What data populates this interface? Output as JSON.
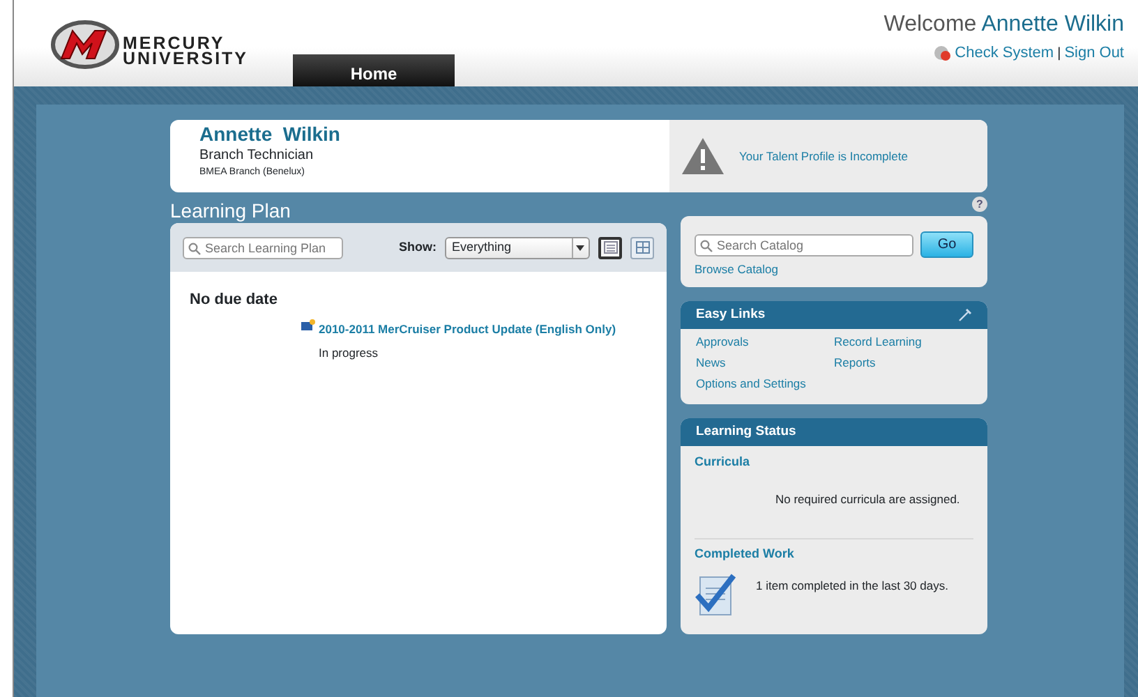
{
  "logo": {
    "line_1": "MERCURY",
    "line_2": "UNIVERSITY"
  },
  "nav_tabs": [
    {
      "label": "Home",
      "selected": true
    }
  ],
  "header": {
    "welcome": "Welcome",
    "user_name": "Annette Wilkin",
    "links": [
      "Check System",
      "Sign Out"
    ],
    "separator": "|"
  },
  "profile": {
    "name": "Annette  Wilkin",
    "title": "Branch Technician",
    "branch": "BMEA Branch (Benelux)",
    "alert": "Your Talent Profile is Incomplete"
  },
  "learning_plan": {
    "title": "Learning Plan",
    "search": {
      "placeholder": "Search Learning Plan"
    },
    "show_label": "Show:",
    "show_value": "Everything",
    "view_buttons": [
      {
        "kind": "list",
        "selected": true
      },
      {
        "kind": "grid",
        "selected": false
      }
    ],
    "groups": [
      {
        "heading": "No due date",
        "items": [
          {
            "title": "2010-2011 MerCruiser Product Update (English Only)",
            "status": "In progress"
          }
        ]
      }
    ]
  },
  "help": "?",
  "catalog": {
    "search": {
      "placeholder": "Search Catalog"
    },
    "button": "Go",
    "browse": "Browse Catalog"
  },
  "easy_links": {
    "title": "Easy Links",
    "links": [
      "Approvals",
      "Record Learning",
      "News",
      "Reports",
      "Options and Settings"
    ]
  },
  "learning_status": {
    "title": "Learning Status",
    "sections": [
      {
        "heading": "Curricula",
        "text": "No required curricula are assigned.",
        "icon": false
      },
      {
        "heading": "Completed Work",
        "text": "1 item completed in the last 30 days.",
        "icon": true
      }
    ]
  }
}
